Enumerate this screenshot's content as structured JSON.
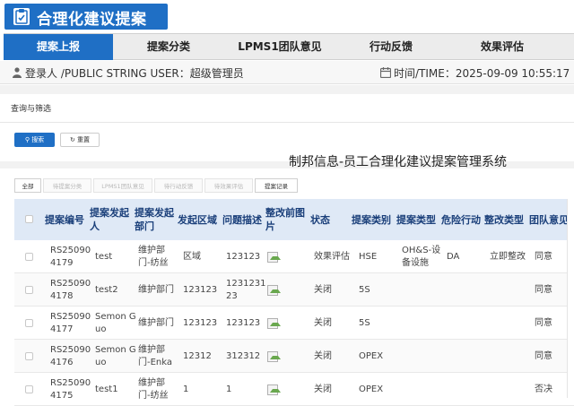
{
  "app": {
    "title": "合理化建议提案"
  },
  "nav": {
    "items": [
      {
        "label": "提案上报",
        "active": true
      },
      {
        "label": "提案分类",
        "active": false
      },
      {
        "label": "LPMS1团队意见",
        "active": false
      },
      {
        "label": "行动反馈",
        "active": false
      },
      {
        "label": "效果评估",
        "active": false
      }
    ]
  },
  "userbar": {
    "user_text": "登录人 /PUBLIC STRING USER：超级管理员",
    "time_text": "时间/TIME：2025-09-09 10:55:17"
  },
  "query": {
    "title": "查询与筛选",
    "search_label": "搜索",
    "reset_label": "重置"
  },
  "system_title": "制邦信息-员工合理化建议提案管理系统",
  "tabs": [
    {
      "label": "全部",
      "active": true
    },
    {
      "label": "待提案分类",
      "active": false
    },
    {
      "label": "LPMS1团队意见",
      "active": false
    },
    {
      "label": "待行动反馈",
      "active": false
    },
    {
      "label": "待效果评估",
      "active": false
    },
    {
      "label": "提案记录",
      "active": true
    }
  ],
  "table": {
    "headers": [
      "提案编号",
      "提案发起人",
      "提案发起部门",
      "发起区域",
      "问题描述",
      "整改前图片",
      "状态",
      "提案类别",
      "提案类型",
      "危险行动",
      "整改类型",
      "团队意见"
    ],
    "rows": [
      {
        "id": "RS25090\n4179",
        "creator": "test",
        "dept": "维护部\n门-纺丝",
        "area": "区域",
        "desc": "123123",
        "status": "效果评估",
        "category": "HSE",
        "type": "OH&S-设\n备设施",
        "danger": "DA",
        "fix": "立即整改",
        "opinion": "同意"
      },
      {
        "id": "RS25090\n4178",
        "creator": "test2",
        "dept": "维护部门",
        "area": "123123",
        "desc": "1231231\n23",
        "status": "关闭",
        "category": "5S",
        "type": "",
        "danger": "",
        "fix": "",
        "opinion": "同意"
      },
      {
        "id": "RS25090\n4177",
        "creator": "Semon G\nuo",
        "dept": "维护部门",
        "area": "123123",
        "desc": "123123",
        "status": "关闭",
        "category": "5S",
        "type": "",
        "danger": "",
        "fix": "",
        "opinion": "同意"
      },
      {
        "id": "RS25090\n4176",
        "creator": "Semon G\nuo",
        "dept": "维护部\n门-Enka",
        "area": "12312",
        "desc": "312312",
        "status": "关闭",
        "category": "OPEX",
        "type": "",
        "danger": "",
        "fix": "",
        "opinion": "同意"
      },
      {
        "id": "RS25090\n4175",
        "creator": "test1",
        "dept": "维护部\n门-纺丝",
        "area": "1",
        "desc": "1",
        "status": "关闭",
        "category": "OPEX",
        "type": "",
        "danger": "",
        "fix": "",
        "opinion": "否决"
      }
    ]
  },
  "colors": {
    "brand": "#1f6fc5",
    "header_bg": "#dfe9f6",
    "header_text": "#1a3f7a"
  }
}
